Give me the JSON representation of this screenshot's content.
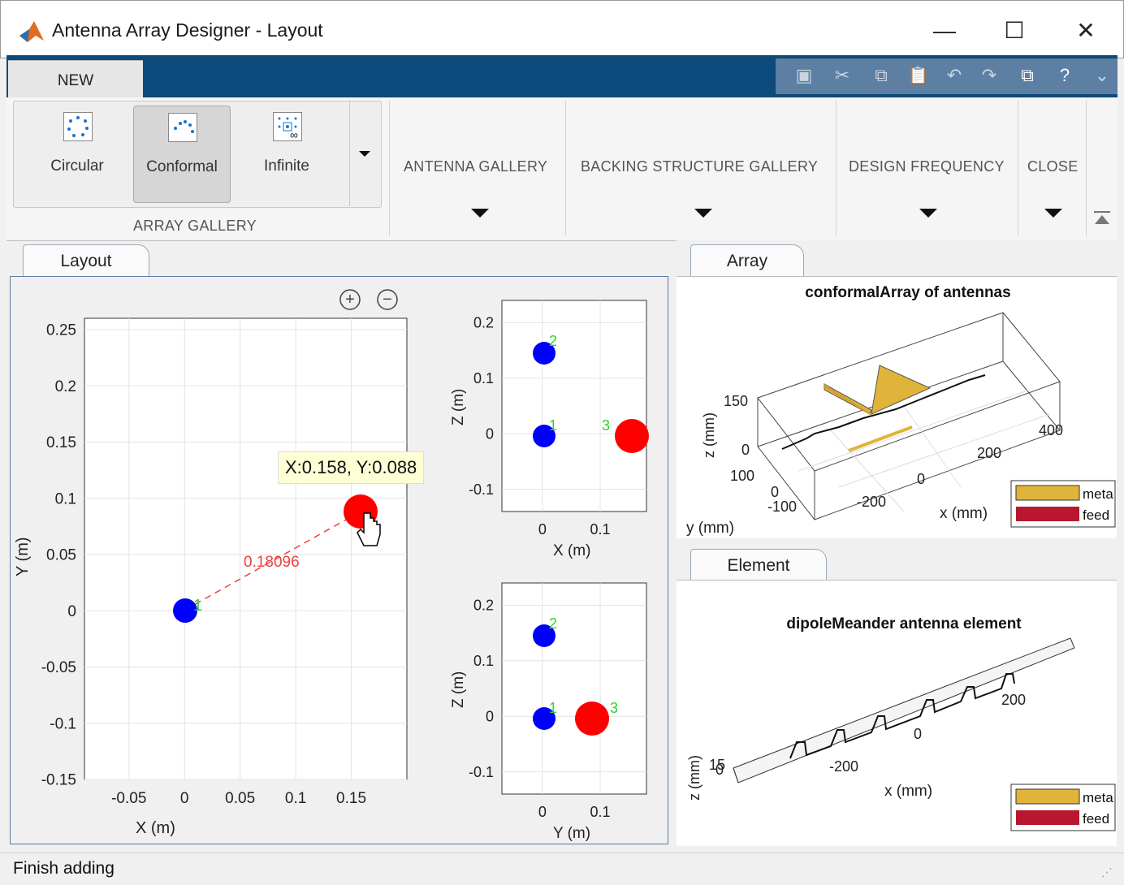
{
  "window": {
    "title": "Antenna Array Designer - Layout",
    "minimize_glyph": "—",
    "maximize_glyph": "☐",
    "close_glyph": "✕"
  },
  "ribbon": {
    "tab": "NEW",
    "array_gallery": {
      "items": [
        "Circular",
        "Conformal",
        "Infinite"
      ],
      "selected": "Conformal",
      "group_label": "ARRAY GALLERY"
    },
    "sections": [
      "ANTENNA GALLERY",
      "BACKING STRUCTURE GALLERY",
      "DESIGN FREQUENCY",
      "CLOSE"
    ],
    "quick_access_icons": [
      "save-icon",
      "cut-icon",
      "copy-icon",
      "paste-icon",
      "undo-icon",
      "redo-icon",
      "window-icon",
      "help-icon",
      "options-icon"
    ]
  },
  "layout_panel": {
    "tab": "Layout",
    "zoom_in": "+",
    "zoom_out": "−",
    "datatip": "X:0.158, Y:0.088",
    "distance_label": "0.18096",
    "main_plot": {
      "xlabel": "X (m)",
      "ylabel": "Y (m)",
      "xticks": [
        "-0.05",
        "0",
        "0.05",
        "0.1",
        "0.15"
      ],
      "yticks": [
        "0.25",
        "0.2",
        "0.15",
        "0.1",
        "0.05",
        "0",
        "-0.05",
        "-0.1",
        "-0.15"
      ]
    },
    "xz_plot": {
      "xlabel": "X (m)",
      "ylabel": "Z (m)",
      "xticks": [
        "0",
        "0.1"
      ],
      "yticks": [
        "0.2",
        "0.1",
        "0",
        "-0.1"
      ]
    },
    "yz_plot": {
      "xlabel": "Y (m)",
      "ylabel": "Z (m)",
      "xticks": [
        "0",
        "0.1"
      ],
      "yticks": [
        "0.2",
        "0.1",
        "0",
        "-0.1"
      ]
    },
    "element_labels": [
      "1",
      "2",
      "3"
    ]
  },
  "array_panel": {
    "tab": "Array",
    "title": "conformalArray of antennas",
    "zlabel": "z (mm)",
    "ylabel": "y (mm)",
    "xlabel": "x (mm)",
    "z_ticks": [
      "150",
      "0"
    ],
    "y_ticks": [
      "100",
      "0",
      "-100"
    ],
    "x_ticks": [
      "-200",
      "0",
      "200",
      "400"
    ],
    "legend": [
      {
        "label": "meta",
        "color": "#e0b43a"
      },
      {
        "label": "feed",
        "color": "#b8172f"
      }
    ]
  },
  "element_panel": {
    "tab": "Element",
    "title": "dipoleMeander antenna element",
    "zlabel": "z (mm)",
    "xlabel": "x (mm)",
    "z_ticks": [
      "15",
      "0"
    ],
    "x_ticks": [
      "-200",
      "0",
      "200"
    ],
    "legend": [
      {
        "label": "meta",
        "color": "#e0b43a"
      },
      {
        "label": "feed",
        "color": "#b8172f"
      }
    ]
  },
  "status": "Finish adding",
  "chart_data": [
    {
      "type": "scatter",
      "title": "",
      "xlabel": "X (m)",
      "ylabel": "Y (m)",
      "xlim": [
        -0.09,
        0.2
      ],
      "ylim": [
        -0.15,
        0.26
      ],
      "series": [
        {
          "label": "1",
          "x": 0,
          "y": 0,
          "color": "#0000ff"
        },
        {
          "label": "2",
          "x": 0,
          "y": 0,
          "color": "#0000ff"
        },
        {
          "label": "3",
          "x": 0.158,
          "y": 0.088,
          "color": "#ff0000"
        }
      ]
    },
    {
      "type": "scatter",
      "xlabel": "X (m)",
      "ylabel": "Z (m)",
      "xlim": [
        -0.07,
        0.18
      ],
      "ylim": [
        -0.14,
        0.24
      ],
      "series": [
        {
          "label": "1",
          "x": 0,
          "y": 0,
          "color": "#0000ff"
        },
        {
          "label": "2",
          "x": 0,
          "y": 0.15,
          "color": "#0000ff"
        },
        {
          "label": "3",
          "x": 0.158,
          "y": 0,
          "color": "#ff0000"
        }
      ]
    },
    {
      "type": "scatter",
      "xlabel": "Y (m)",
      "ylabel": "Z (m)",
      "xlim": [
        -0.07,
        0.18
      ],
      "ylim": [
        -0.14,
        0.24
      ],
      "series": [
        {
          "label": "1",
          "x": 0,
          "y": 0,
          "color": "#0000ff"
        },
        {
          "label": "2",
          "x": 0,
          "y": 0.15,
          "color": "#0000ff"
        },
        {
          "label": "3",
          "x": 0.088,
          "y": 0,
          "color": "#ff0000"
        }
      ]
    }
  ]
}
